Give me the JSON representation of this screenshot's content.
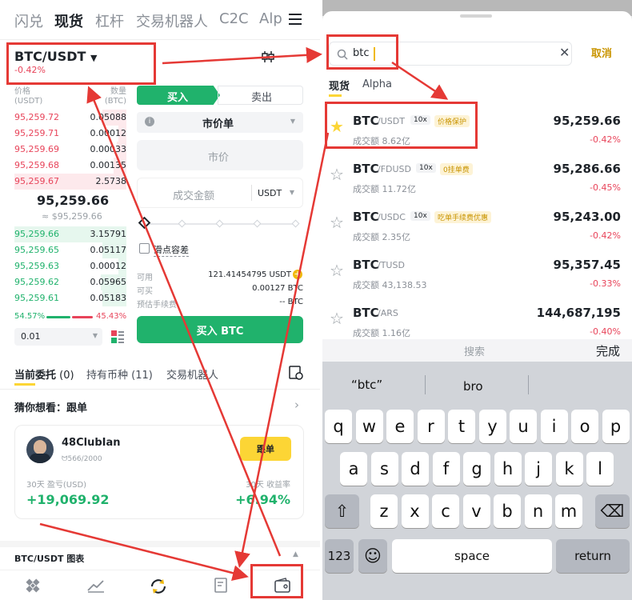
{
  "left": {
    "topnav": [
      "闪兑",
      "现货",
      "杠杆",
      "交易机器人",
      "C2C",
      "Alp"
    ],
    "pair": "BTC/USDT",
    "pair_change": "-0.42%",
    "ob_header": {
      "price": "价格",
      "price_unit": "(USDT)",
      "qty": "数量",
      "qty_unit": "(BTC)"
    },
    "asks": [
      {
        "p": "95,259.72",
        "q": "0.05088"
      },
      {
        "p": "95,259.71",
        "q": "0.00012"
      },
      {
        "p": "95,259.69",
        "q": "0.00033"
      },
      {
        "p": "95,259.68",
        "q": "0.00135"
      },
      {
        "p": "95,259.67",
        "q": "2.5738"
      }
    ],
    "mid_price": "95,259.66",
    "mid_usd": "≈ $95,259.66",
    "bids": [
      {
        "p": "95,259.66",
        "q": "3.15791"
      },
      {
        "p": "95,259.65",
        "q": "0.05117"
      },
      {
        "p": "95,259.63",
        "q": "0.00012"
      },
      {
        "p": "95,259.62",
        "q": "0.05965"
      },
      {
        "p": "95,259.61",
        "q": "0.05183"
      }
    ],
    "buy_pct": "54.57%",
    "sell_pct": "45.43%",
    "depth": "0.01",
    "buy_tab": "买入",
    "sell_tab": "卖出",
    "order_type": "市价单",
    "price_field": "市价",
    "amount_field": "成交金额",
    "amount_unit": "USDT",
    "slippage": "滑点容差",
    "avail_label": "可用",
    "avail_value": "121.41454795 USDT",
    "canbuy_label": "可买",
    "canbuy_value": "0.00127 BTC",
    "fee_label": "预估手续费",
    "fee_value": "-- BTC",
    "buy_button": "买入 BTC",
    "tabs": {
      "orders": "当前委托",
      "orders_count": "(0)",
      "holdings": "持有币种",
      "holdings_count": "(11)",
      "bots": "交易机器人"
    },
    "guess": "猜你想看：跟单",
    "card": {
      "name": "48ClubIan",
      "followers": "566/2000",
      "follow_btn": "跟单",
      "pnl_label": "30天 盈亏(USD)",
      "pnl_value": "+19,069.92",
      "roi_label": "30天 收益率",
      "roi_value": "+6.94%"
    },
    "chart_label": "BTC/USDT 图表"
  },
  "right": {
    "search_value": "btc",
    "cancel": "取消",
    "tabs": [
      "现货",
      "Alpha"
    ],
    "coins": [
      {
        "sym": "BTC",
        "quote": "/USDT",
        "lev": "10x",
        "tag": "价格保护",
        "vol": "成交额 8.62亿",
        "price": "95,259.66",
        "chg": "-0.42%",
        "fav": true
      },
      {
        "sym": "BTC",
        "quote": "/FDUSD",
        "lev": "10x",
        "tag": "0挂单费",
        "vol": "成交额 11.72亿",
        "price": "95,286.66",
        "chg": "-0.45%",
        "fav": false
      },
      {
        "sym": "BTC",
        "quote": "/USDC",
        "lev": "10x",
        "tag": "吃单手续费优惠",
        "vol": "成交额 2.35亿",
        "price": "95,243.00",
        "chg": "-0.42%",
        "fav": false
      },
      {
        "sym": "BTC",
        "quote": "/TUSD",
        "lev": "",
        "tag": "",
        "vol": "成交额 43,138.53",
        "price": "95,357.45",
        "chg": "-0.33%",
        "fav": false
      },
      {
        "sym": "BTC",
        "quote": "/ARS",
        "lev": "",
        "tag": "",
        "vol": "成交额 1.16亿",
        "price": "144,687,195",
        "chg": "-0.40%",
        "fav": false
      }
    ],
    "kb_search": "搜索",
    "kb_done": "完成",
    "suggestions": [
      "“btc”",
      "bro",
      ""
    ],
    "row1": [
      "q",
      "w",
      "e",
      "r",
      "t",
      "y",
      "u",
      "i",
      "o",
      "p"
    ],
    "row2": [
      "a",
      "s",
      "d",
      "f",
      "g",
      "h",
      "j",
      "k",
      "l"
    ],
    "row3": [
      "z",
      "x",
      "c",
      "v",
      "b",
      "n",
      "m"
    ],
    "k123": "123",
    "space": "space",
    "return": "return"
  },
  "colors": {
    "green": "#20b26c",
    "red": "#e8445a",
    "yellow": "#fcd535",
    "annotation": "#e53935"
  }
}
